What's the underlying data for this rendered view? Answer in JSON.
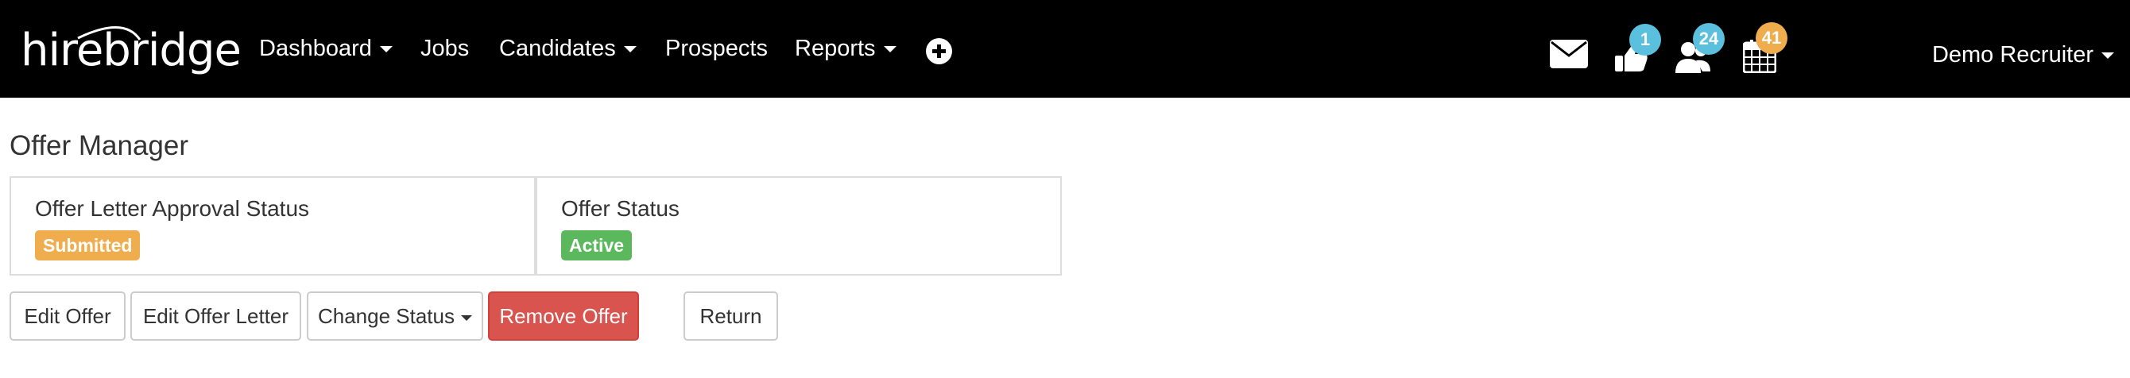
{
  "brand": {
    "logo_text": "hirebridge"
  },
  "nav": {
    "dashboard": "Dashboard",
    "jobs": "Jobs",
    "candidates": "Candidates",
    "prospects": "Prospects",
    "reports": "Reports"
  },
  "header_icons": {
    "approvals_badge": "1",
    "people_badge": "24",
    "calendar_badge": "41"
  },
  "user": {
    "name": "Demo Recruiter"
  },
  "page": {
    "title": "Offer Manager"
  },
  "panels": {
    "approval": {
      "heading": "Offer Letter Approval Status",
      "status": "Submitted"
    },
    "offer": {
      "heading": "Offer Status",
      "status": "Active"
    }
  },
  "actions": {
    "edit_offer": "Edit Offer",
    "edit_offer_letter": "Edit Offer Letter",
    "change_status": "Change Status",
    "remove_offer": "Remove Offer",
    "return": "Return"
  },
  "colors": {
    "navbar_bg": "#000000",
    "badge_blue": "#5bc0de",
    "badge_orange": "#f0ad4e",
    "label_warning": "#f0ad4e",
    "label_success": "#5cb85c",
    "danger": "#d9534f"
  }
}
